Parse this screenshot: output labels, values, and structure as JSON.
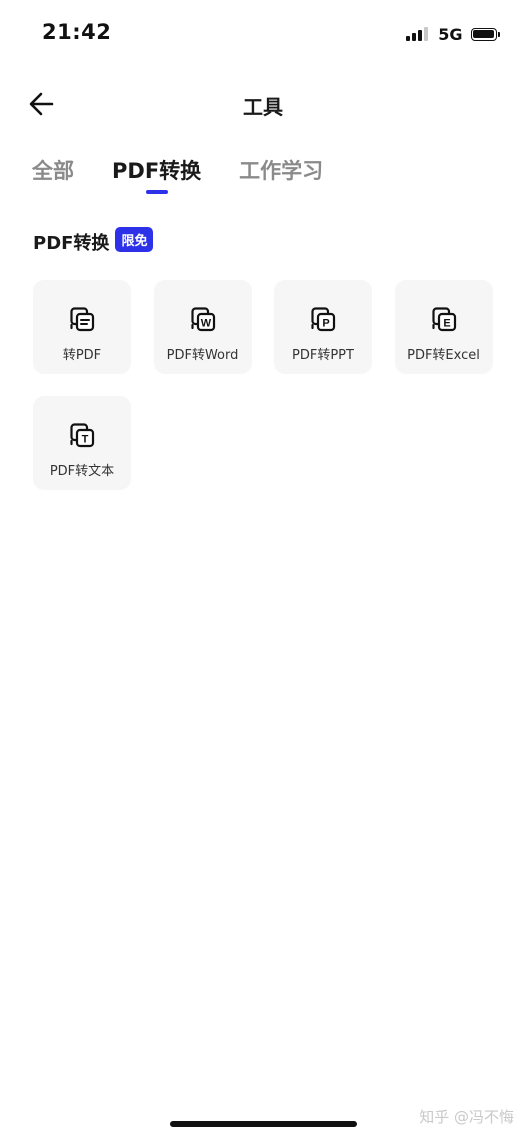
{
  "status_bar": {
    "time": "21:42",
    "network": "5G"
  },
  "header": {
    "back_icon": "arrow-left-icon",
    "title": "工具"
  },
  "tabs": [
    {
      "label": "全部",
      "active": false
    },
    {
      "label": "PDF转换",
      "active": true
    },
    {
      "label": "工作学习",
      "active": false
    }
  ],
  "section": {
    "title": "PDF转换",
    "badge": "限免"
  },
  "tools": [
    {
      "label": "转PDF",
      "icon": "document-convert-icon",
      "glyph": "doc"
    },
    {
      "label": "PDF转Word",
      "icon": "word-convert-icon",
      "glyph": "W"
    },
    {
      "label": "PDF转PPT",
      "icon": "ppt-convert-icon",
      "glyph": "P"
    },
    {
      "label": "PDF转Excel",
      "icon": "excel-convert-icon",
      "glyph": "E"
    },
    {
      "label": "PDF转文本",
      "icon": "text-convert-icon",
      "glyph": "T"
    }
  ],
  "watermark": "知乎 @冯不悔",
  "colors": {
    "accent": "#2d31e8",
    "card_bg": "#f6f6f6",
    "tab_inactive": "#8a8a8a",
    "text": "#1a1a1a"
  }
}
